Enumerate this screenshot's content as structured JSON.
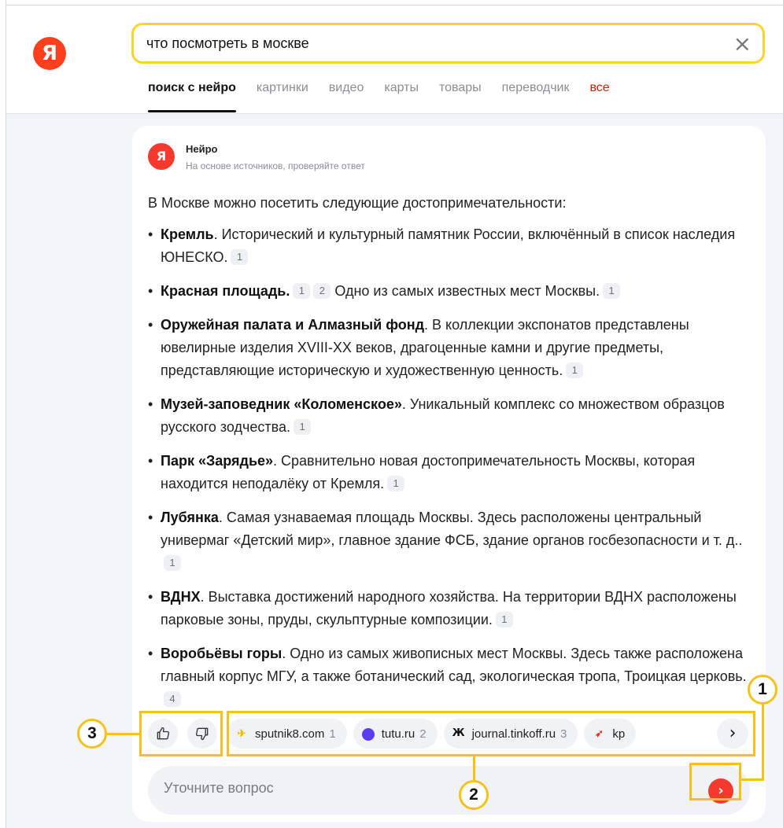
{
  "search": {
    "value": "что посмотреть в москве",
    "clear_icon": "×"
  },
  "logo": {
    "text": "Я"
  },
  "tabs": [
    {
      "label": "поиск с нейро"
    },
    {
      "label": "картинки"
    },
    {
      "label": "видео"
    },
    {
      "label": "карты"
    },
    {
      "label": "товары"
    },
    {
      "label": "переводчик"
    },
    {
      "label": "все"
    }
  ],
  "answer": {
    "author": "Нейро",
    "subtitle": "На основе источников, проверяйте ответ",
    "intro": "В Москве можно посетить следующие достопримечательности:",
    "items": [
      {
        "title": "Кремль",
        "text": ". Исторический и культурный памятник России, включённый в список наследия ЮНЕСКО.",
        "cites": [
          "1"
        ]
      },
      {
        "title": "Красная площадь.",
        "cites_mid": [
          "1",
          "2"
        ],
        "text": " Одно из самых известных мест Москвы.",
        "cites": [
          "1"
        ]
      },
      {
        "title": "Оружейная палата и Алмазный фонд",
        "text": ". В коллекции экспонатов представлены ювелирные изделия XVIII-XX веков, драгоценные камни и другие предметы, представляющие историческую и художественную ценность.",
        "cites": [
          "1"
        ]
      },
      {
        "title": "Музей-заповедник «Коломенское»",
        "text": ". Уникальный комплекс со множеством образцов русского зодчества.",
        "cites": [
          "1"
        ]
      },
      {
        "title": "Парк «Зарядье»",
        "text": ". Сравнительно новая достопримечательность Москвы, которая находится неподалёку от Кремля.",
        "cites": [
          "1"
        ]
      },
      {
        "title": "Лубянка",
        "text": ". Самая узнаваемая площадь Москвы. Здесь расположены центральный универмаг «Детский мир», главное здание ФСБ, здание органов госбезопасности и т. д..",
        "cites": [
          "1"
        ]
      },
      {
        "title": "ВДНХ",
        "text": ". Выставка достижений народного хозяйства. На территории ВДНХ расположены парковые зоны, пруды, скульптурные композиции.",
        "cites": [
          "1"
        ]
      },
      {
        "title": "Воробьёвы горы",
        "text": ". Одно из самых живописных мест Москвы. Здесь также расположена главный корпус МГУ, а также ботанический сад, экологическая тропа, Троицкая церковь.",
        "cites": [
          "4"
        ]
      }
    ]
  },
  "sources": [
    {
      "name": "sputnik8.com",
      "num": "1",
      "icon": "sputnik-icon",
      "color": "#f5b800"
    },
    {
      "name": "tutu.ru",
      "num": "2",
      "icon": "tutu-icon",
      "color": "#5b3cf5"
    },
    {
      "name": "journal.tinkoff.ru",
      "num": "3",
      "icon": "tinkoff-journal-icon",
      "color": "#111111"
    },
    {
      "name": "kp",
      "num": "",
      "icon": "kp-icon",
      "color": "#e5322d"
    }
  ],
  "ask": {
    "placeholder": "Уточните вопрос"
  },
  "markers": {
    "one": "1",
    "two": "2",
    "three": "3"
  },
  "colors": {
    "brand": "#fc3f1d",
    "highlight": "#f5c21b",
    "search_border": "#fed42b",
    "all_tab": "#e61400"
  }
}
